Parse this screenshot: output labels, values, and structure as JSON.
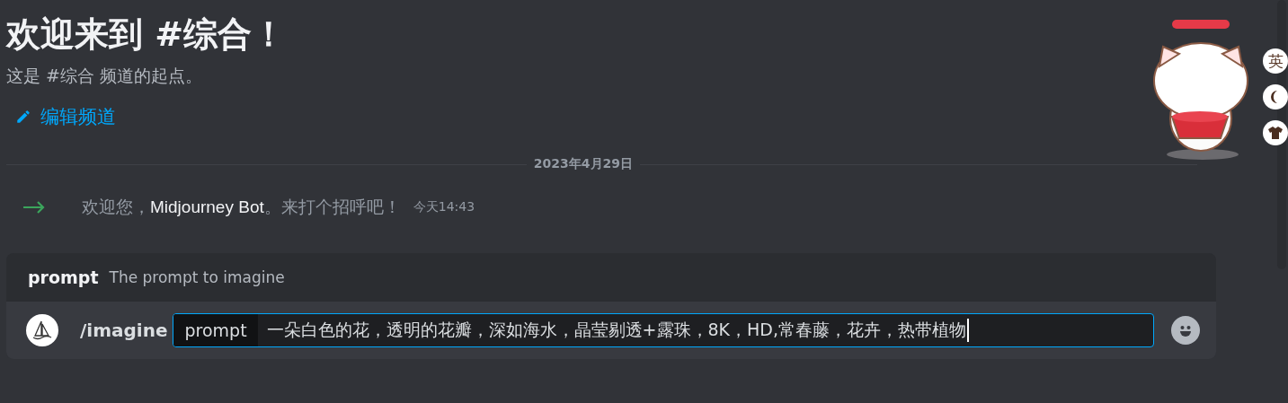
{
  "welcome": {
    "title": "欢迎来到 #综合！",
    "subtitle": "这是 #综合 频道的起点。",
    "edit_link": "编辑频道"
  },
  "divider": {
    "date": "2023年4月29日"
  },
  "messages": [
    {
      "kind": "join",
      "before": "欢迎您，",
      "name": "Midjourney Bot",
      "after": "。来打个招呼吧！",
      "time": "今天14:43"
    }
  ],
  "command": {
    "option_name": "prompt",
    "option_description": "The prompt to imagine",
    "name": "/imagine",
    "tag": "prompt",
    "value": "一朵白色的花，透明的花瓣，深如海水，晶莹剔透+露珠，8K，HD,常春藤，花卉，热带植物"
  },
  "ime_toolbar": {
    "language": "英"
  }
}
